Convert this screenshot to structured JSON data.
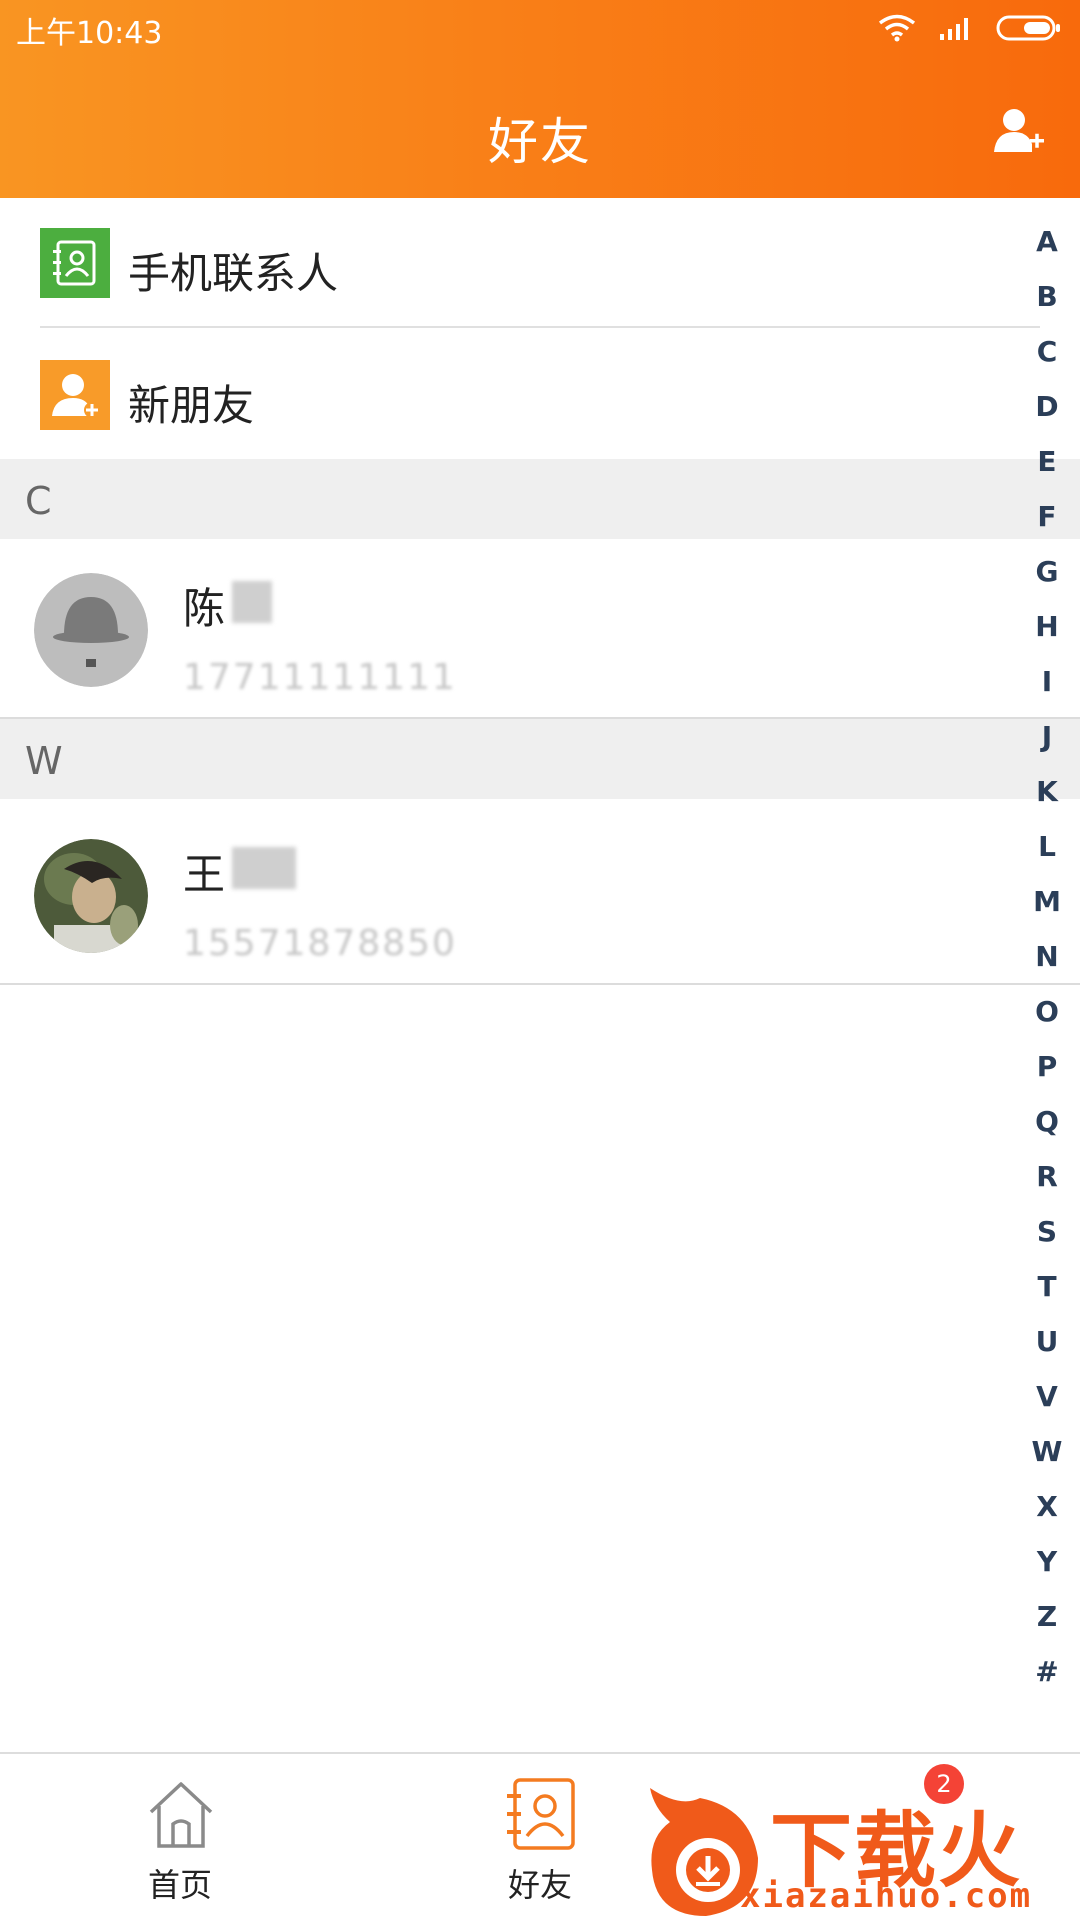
{
  "status_bar": {
    "time": "上午10:43"
  },
  "header": {
    "title": "好友"
  },
  "features": [
    {
      "label": "手机联系人",
      "icon": "contacts-book-icon",
      "color": "#4cae3f"
    },
    {
      "label": "新朋友",
      "icon": "new-friend-icon",
      "color": "#f89b29"
    }
  ],
  "sections": [
    {
      "letter": "C",
      "contact": {
        "name": "陈",
        "phone": "17711111111",
        "avatar": "bowler-hat-avatar"
      }
    },
    {
      "letter": "W",
      "contact": {
        "name": "王",
        "phone": "15571878850",
        "avatar": "photo-avatar"
      }
    }
  ],
  "index": [
    "A",
    "B",
    "C",
    "D",
    "E",
    "F",
    "G",
    "H",
    "I",
    "J",
    "K",
    "L",
    "M",
    "N",
    "O",
    "P",
    "Q",
    "R",
    "S",
    "T",
    "U",
    "V",
    "W",
    "X",
    "Y",
    "Z",
    "#"
  ],
  "tabbar": {
    "tabs": [
      {
        "label": "首页",
        "icon": "home-icon"
      },
      {
        "label": "好友",
        "icon": "friends-contact-icon",
        "active": true
      }
    ],
    "badge_count": "2"
  },
  "watermark": {
    "text": "下载火",
    "url": "xiazaihuo.com"
  },
  "colors": {
    "accent": "#f98018",
    "index_text": "#2b3e58"
  }
}
